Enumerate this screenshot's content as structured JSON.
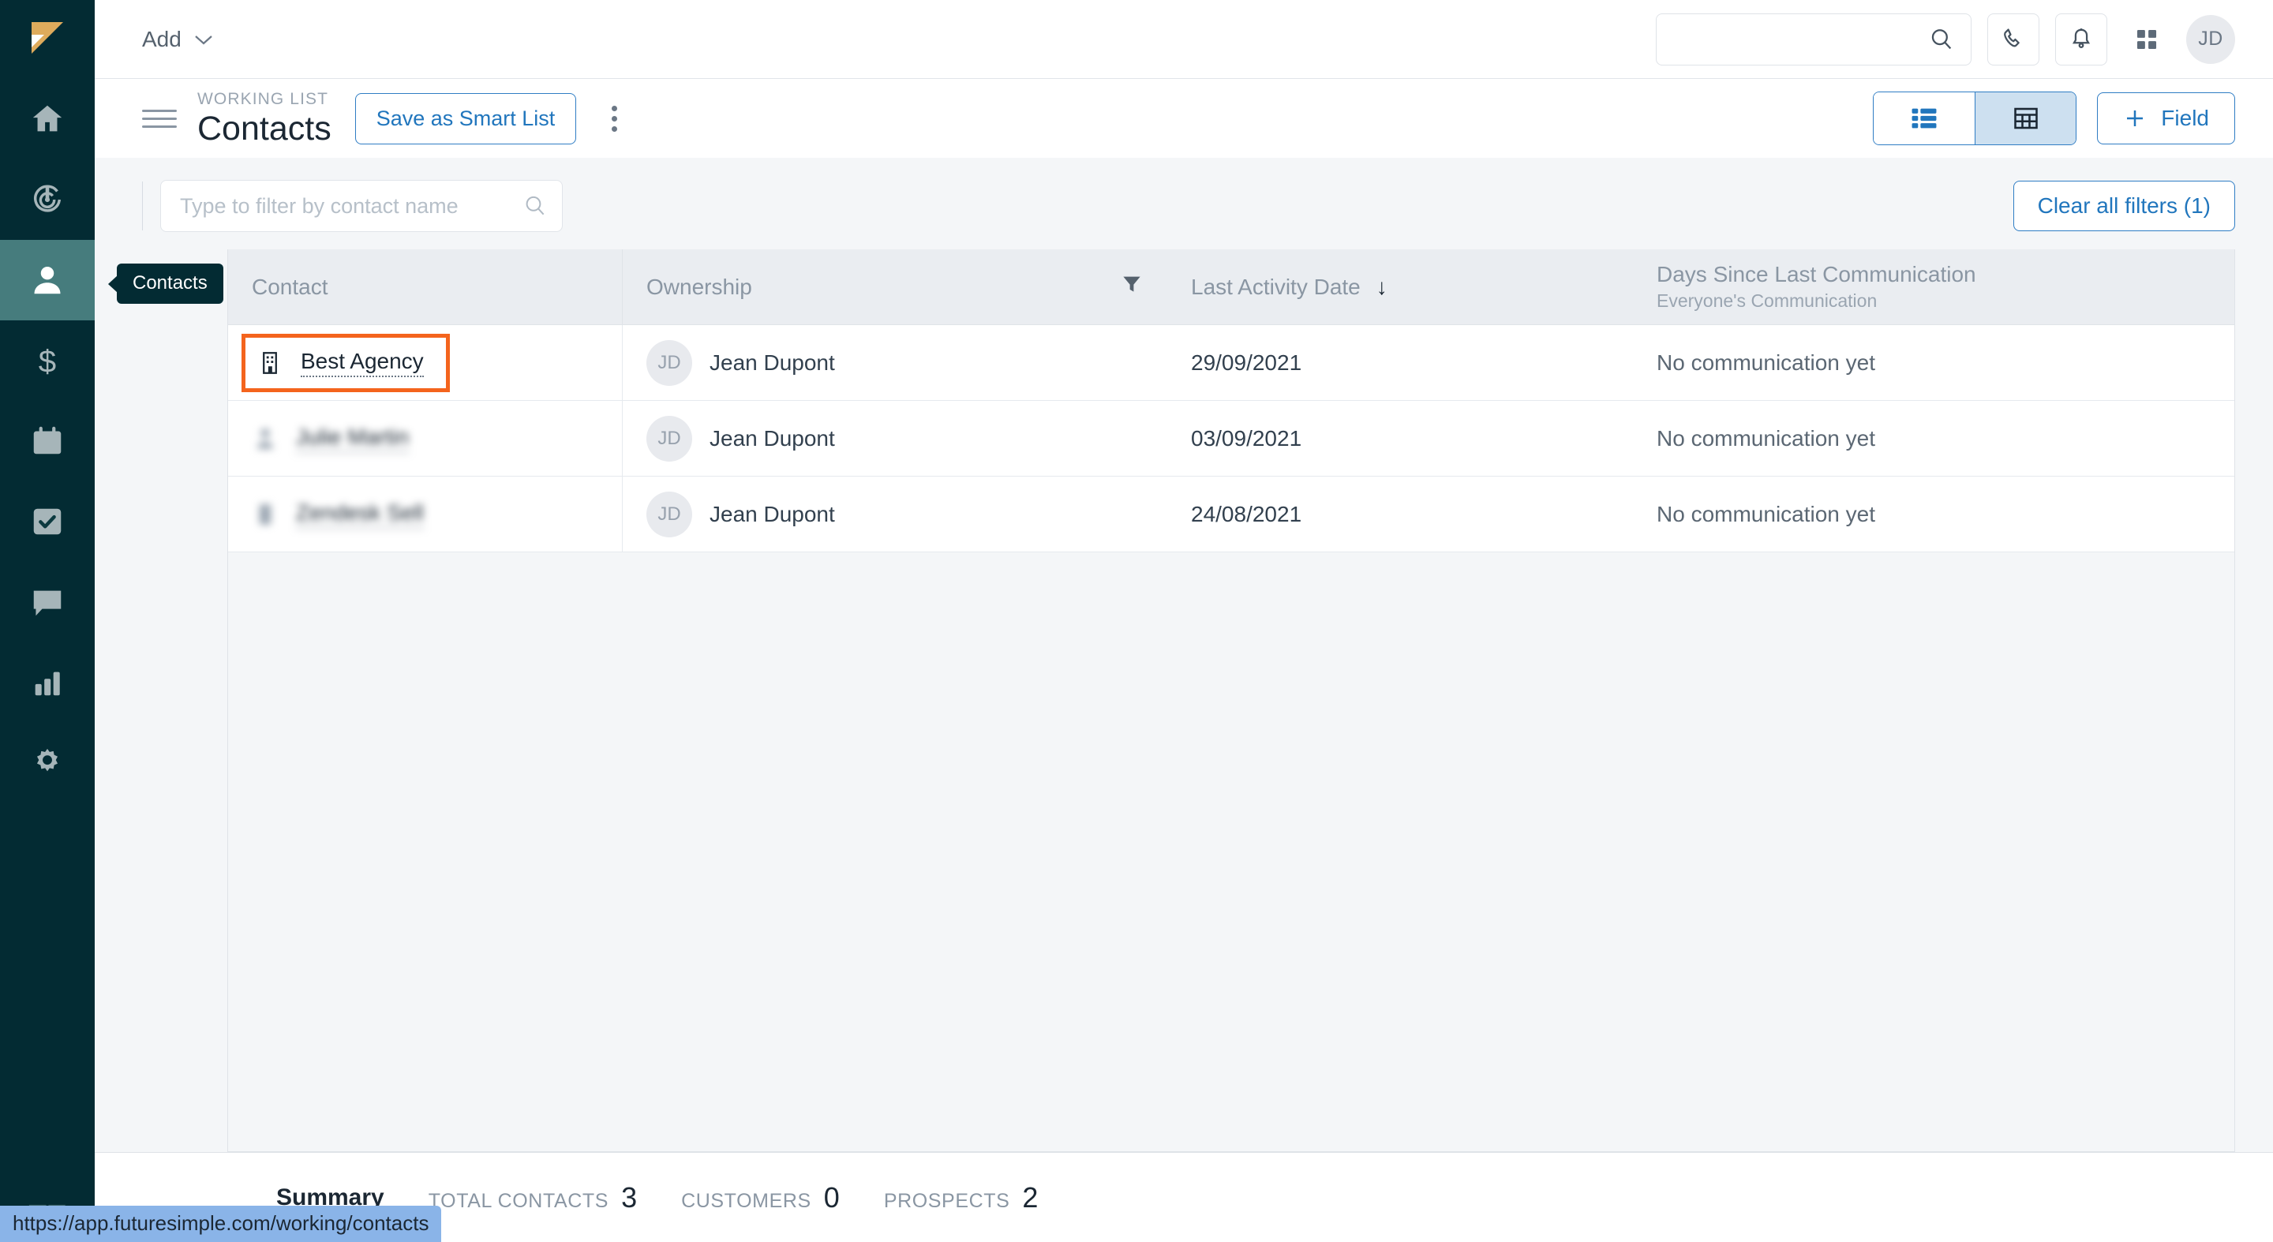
{
  "sidebar": {
    "logo": "zendesk-sell-logo",
    "items": [
      {
        "name": "home",
        "icon": "home-icon",
        "active": false
      },
      {
        "name": "leads",
        "icon": "target-icon",
        "active": false
      },
      {
        "name": "contacts",
        "icon": "person-icon",
        "active": true
      },
      {
        "name": "deals",
        "icon": "dollar-icon",
        "active": false
      },
      {
        "name": "calendar",
        "icon": "calendar-icon",
        "active": false
      },
      {
        "name": "tasks",
        "icon": "check-square-icon",
        "active": false
      },
      {
        "name": "communication",
        "icon": "chat-bubble-icon",
        "active": false
      },
      {
        "name": "reports",
        "icon": "bar-chart-icon",
        "active": false
      },
      {
        "name": "settings",
        "icon": "gear-icon",
        "active": false
      }
    ],
    "bottom_logo": "zendesk-logo"
  },
  "topbar": {
    "add_label": "Add",
    "add_caret": "chevron-down-icon",
    "search": {
      "placeholder": "",
      "value": "",
      "icon": "search-icon"
    },
    "phone_icon": "phone-icon",
    "bell_icon": "bell-icon",
    "apps_icon": "grid-apps-icon",
    "avatar_initials": "JD"
  },
  "header": {
    "menu_icon": "hamburger-icon",
    "eyebrow": "WORKING LIST",
    "title": "Contacts",
    "smart_list_label": "Save as Smart List",
    "kebab_icon": "more-vertical-icon",
    "view_toggle": {
      "list_icon": "list-view-icon",
      "table_icon": "table-view-icon",
      "active": "table"
    },
    "field_label": "Field",
    "field_icon": "plus-icon"
  },
  "filters": {
    "tooltip": "Contacts",
    "input_placeholder": "Type to filter by contact name",
    "input_value": "",
    "search_icon": "search-icon",
    "clear_label": "Clear all filters (1)"
  },
  "table": {
    "columns": [
      {
        "label": "Contact",
        "sub": "",
        "filter_icon": false,
        "sort_icon": ""
      },
      {
        "label": "Ownership",
        "sub": "",
        "filter_icon": true,
        "sort_icon": ""
      },
      {
        "label": "Last Activity Date",
        "sub": "",
        "filter_icon": false,
        "sort_icon": "↓"
      },
      {
        "label": "Days Since Last Communication",
        "sub": "Everyone's Communication",
        "filter_icon": false,
        "sort_icon": ""
      }
    ],
    "rows": [
      {
        "contact": "Best Agency",
        "contact_icon": "building-icon",
        "highlighted": true,
        "blurred": false,
        "owner_initials": "JD",
        "owner": "Jean Dupont",
        "last_activity": "29/09/2021",
        "days_since": "No communication yet"
      },
      {
        "contact": "Julie Martin",
        "contact_icon": "person-icon",
        "highlighted": false,
        "blurred": true,
        "owner_initials": "JD",
        "owner": "Jean Dupont",
        "last_activity": "03/09/2021",
        "days_since": "No communication yet"
      },
      {
        "contact": "Zendesk Sell",
        "contact_icon": "building-icon",
        "highlighted": false,
        "blurred": true,
        "owner_initials": "JD",
        "owner": "Jean Dupont",
        "last_activity": "24/08/2021",
        "days_since": "No communication yet"
      }
    ]
  },
  "summary": {
    "title": "Summary",
    "stats": [
      {
        "label": "TOTAL CONTACTS",
        "value": "3"
      },
      {
        "label": "CUSTOMERS",
        "value": "0"
      },
      {
        "label": "PROSPECTS",
        "value": "2"
      }
    ]
  },
  "status_bar": {
    "url": "https://app.futuresimple.com/working/contacts"
  },
  "colors": {
    "sidebar_bg": "#032b33",
    "sidebar_active": "#467c7d",
    "accent_blue": "#2176bd",
    "highlight_orange": "#f4641d",
    "logo_gold": "#deab5c",
    "page_bg": "#f4f6f8"
  }
}
